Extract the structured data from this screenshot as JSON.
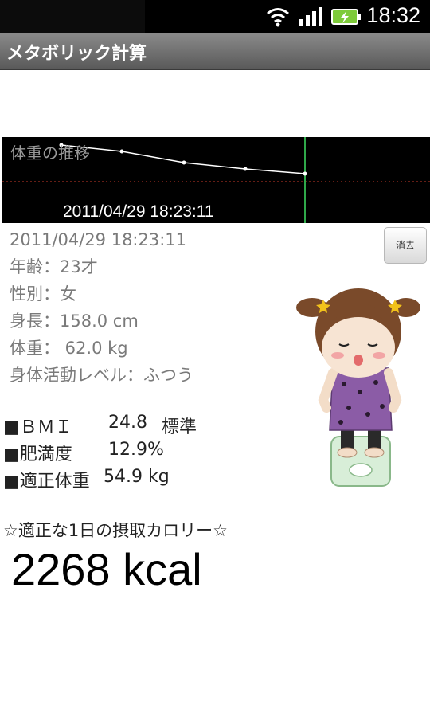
{
  "status_bar": {
    "time": "18:32",
    "icons": [
      "wifi-icon",
      "signal-icon",
      "battery-charging-icon"
    ]
  },
  "app": {
    "title": "メタボリック計算"
  },
  "graph": {
    "title": "体重の推移",
    "date_label": "2011/04/29 18:23:11",
    "background": "#000000",
    "line_color": "#ffffff",
    "reference_color": "#c83a2a",
    "cursor_color": "#2fa84a"
  },
  "record": {
    "date": "2011/04/29 18:23:11",
    "age": "年齢：23才",
    "sex": "性別：女",
    "height": "身長：158.0 cm",
    "weight": "体重： 62.0 kg",
    "activity": "身体活動レベル：ふつう",
    "delete_label": "消去"
  },
  "stats": {
    "bmi_label": "■ＢＭＩ",
    "bmi_value": "24.8",
    "bmi_status": "標準",
    "obesity_label": "■肥満度",
    "obesity_value": "12.9%",
    "ideal_label": "■適正体重",
    "ideal_value": "54.9 kg"
  },
  "calorie": {
    "label": "☆適正な1日の摂取カロリー☆",
    "value": "2268 kcal"
  }
}
